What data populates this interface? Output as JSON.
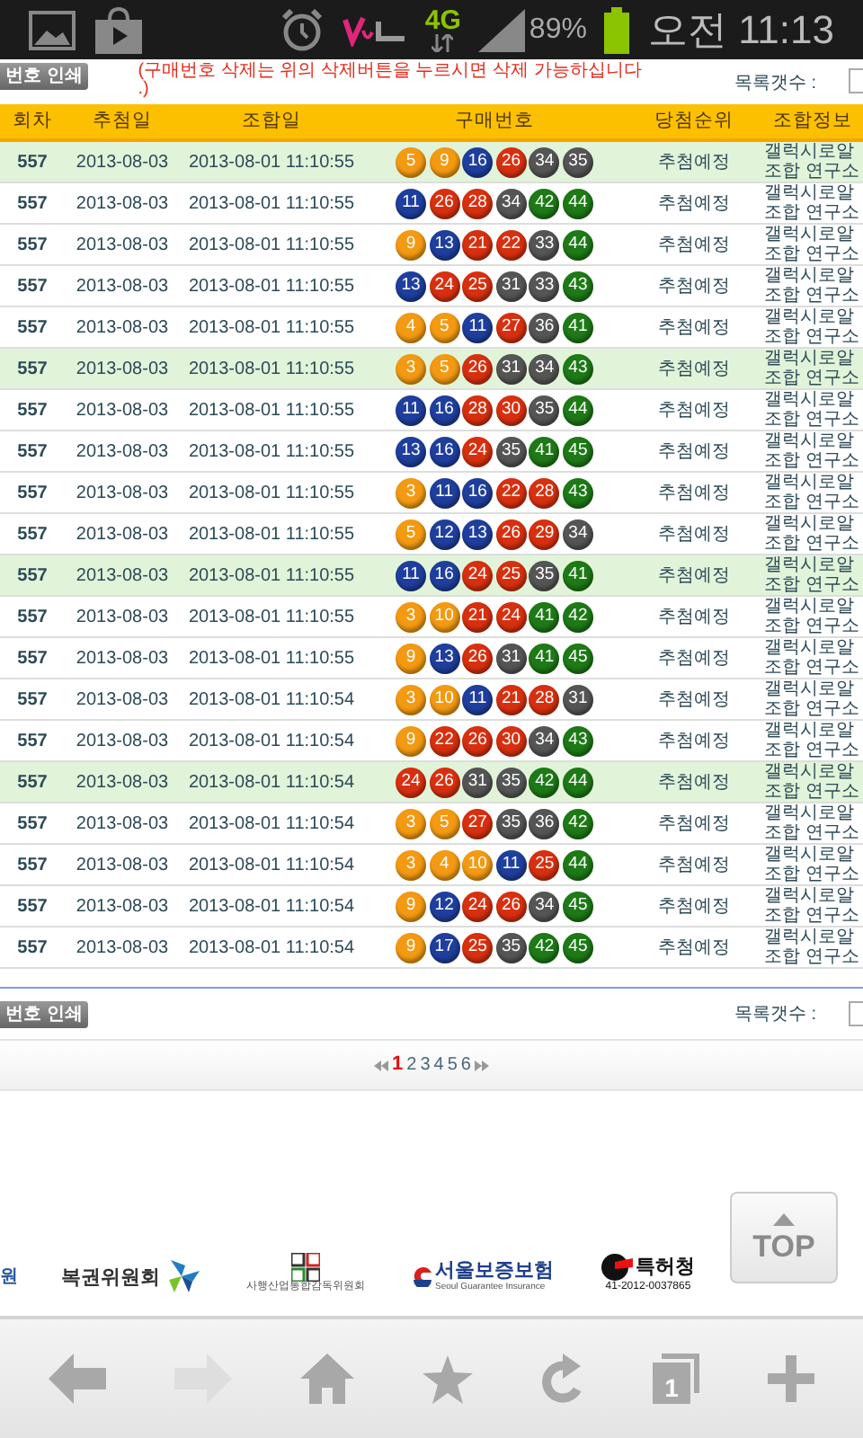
{
  "status_bar": {
    "network": "4G",
    "battery": "89%",
    "time": "오전 11:13"
  },
  "top_bar": {
    "print_button": "번호 인쇄",
    "notice_lines": [
      "(구매번호 삭제는 위의 삭제버튼을 누르시면 삭제 가능하십니다",
      ".)"
    ],
    "list_count_label": "목록갯수 :"
  },
  "table": {
    "columns": [
      "회차",
      "추첨일",
      "조합일",
      "구매번호",
      "당첨순위",
      "조합정보"
    ],
    "rows": [
      {
        "round": "557",
        "draw_date": "2013-08-03",
        "combo_date": "2013-08-01 11:10:55",
        "highlighted": true,
        "balls": [
          {
            "n": "5",
            "color": "#f39a12"
          },
          {
            "n": "9",
            "color": "#f39a12"
          },
          {
            "n": "16",
            "color": "#1f3f9e"
          },
          {
            "n": "26",
            "color": "#d8300f"
          },
          {
            "n": "34",
            "color": "#555555"
          },
          {
            "n": "35",
            "color": "#555555"
          }
        ],
        "rank": "추첨예정",
        "info": [
          "갤럭시로알",
          "조합 연구소"
        ]
      },
      {
        "round": "557",
        "draw_date": "2013-08-03",
        "combo_date": "2013-08-01 11:10:55",
        "highlighted": false,
        "balls": [
          {
            "n": "11",
            "color": "#1f3f9e"
          },
          {
            "n": "26",
            "color": "#d8300f"
          },
          {
            "n": "28",
            "color": "#d8300f"
          },
          {
            "n": "34",
            "color": "#555555"
          },
          {
            "n": "42",
            "color": "#1d7a16"
          },
          {
            "n": "44",
            "color": "#1d7a16"
          }
        ],
        "rank": "추첨예정",
        "info": [
          "갤럭시로알",
          "조합 연구소"
        ]
      },
      {
        "round": "557",
        "draw_date": "2013-08-03",
        "combo_date": "2013-08-01 11:10:55",
        "highlighted": false,
        "balls": [
          {
            "n": "9",
            "color": "#f39a12"
          },
          {
            "n": "13",
            "color": "#1f3f9e"
          },
          {
            "n": "21",
            "color": "#d8300f"
          },
          {
            "n": "22",
            "color": "#d8300f"
          },
          {
            "n": "33",
            "color": "#555555"
          },
          {
            "n": "44",
            "color": "#1d7a16"
          }
        ],
        "rank": "추첨예정",
        "info": [
          "갤럭시로알",
          "조합 연구소"
        ]
      },
      {
        "round": "557",
        "draw_date": "2013-08-03",
        "combo_date": "2013-08-01 11:10:55",
        "highlighted": false,
        "balls": [
          {
            "n": "13",
            "color": "#1f3f9e"
          },
          {
            "n": "24",
            "color": "#d8300f"
          },
          {
            "n": "25",
            "color": "#d8300f"
          },
          {
            "n": "31",
            "color": "#555555"
          },
          {
            "n": "33",
            "color": "#555555"
          },
          {
            "n": "43",
            "color": "#1d7a16"
          }
        ],
        "rank": "추첨예정",
        "info": [
          "갤럭시로알",
          "조합 연구소"
        ]
      },
      {
        "round": "557",
        "draw_date": "2013-08-03",
        "combo_date": "2013-08-01 11:10:55",
        "highlighted": false,
        "balls": [
          {
            "n": "4",
            "color": "#f39a12"
          },
          {
            "n": "5",
            "color": "#f39a12"
          },
          {
            "n": "11",
            "color": "#1f3f9e"
          },
          {
            "n": "27",
            "color": "#d8300f"
          },
          {
            "n": "36",
            "color": "#555555"
          },
          {
            "n": "41",
            "color": "#1d7a16"
          }
        ],
        "rank": "추첨예정",
        "info": [
          "갤럭시로알",
          "조합 연구소"
        ]
      },
      {
        "round": "557",
        "draw_date": "2013-08-03",
        "combo_date": "2013-08-01 11:10:55",
        "highlighted": true,
        "balls": [
          {
            "n": "3",
            "color": "#f39a12"
          },
          {
            "n": "5",
            "color": "#f39a12"
          },
          {
            "n": "26",
            "color": "#d8300f"
          },
          {
            "n": "31",
            "color": "#555555"
          },
          {
            "n": "34",
            "color": "#555555"
          },
          {
            "n": "43",
            "color": "#1d7a16"
          }
        ],
        "rank": "추첨예정",
        "info": [
          "갤럭시로알",
          "조합 연구소"
        ]
      },
      {
        "round": "557",
        "draw_date": "2013-08-03",
        "combo_date": "2013-08-01 11:10:55",
        "highlighted": false,
        "balls": [
          {
            "n": "11",
            "color": "#1f3f9e"
          },
          {
            "n": "16",
            "color": "#1f3f9e"
          },
          {
            "n": "28",
            "color": "#d8300f"
          },
          {
            "n": "30",
            "color": "#d8300f"
          },
          {
            "n": "35",
            "color": "#555555"
          },
          {
            "n": "44",
            "color": "#1d7a16"
          }
        ],
        "rank": "추첨예정",
        "info": [
          "갤럭시로알",
          "조합 연구소"
        ]
      },
      {
        "round": "557",
        "draw_date": "2013-08-03",
        "combo_date": "2013-08-01 11:10:55",
        "highlighted": false,
        "balls": [
          {
            "n": "13",
            "color": "#1f3f9e"
          },
          {
            "n": "16",
            "color": "#1f3f9e"
          },
          {
            "n": "24",
            "color": "#d8300f"
          },
          {
            "n": "35",
            "color": "#555555"
          },
          {
            "n": "41",
            "color": "#1d7a16"
          },
          {
            "n": "45",
            "color": "#1d7a16"
          }
        ],
        "rank": "추첨예정",
        "info": [
          "갤럭시로알",
          "조합 연구소"
        ]
      },
      {
        "round": "557",
        "draw_date": "2013-08-03",
        "combo_date": "2013-08-01 11:10:55",
        "highlighted": false,
        "balls": [
          {
            "n": "3",
            "color": "#f39a12"
          },
          {
            "n": "11",
            "color": "#1f3f9e"
          },
          {
            "n": "16",
            "color": "#1f3f9e"
          },
          {
            "n": "22",
            "color": "#d8300f"
          },
          {
            "n": "28",
            "color": "#d8300f"
          },
          {
            "n": "43",
            "color": "#1d7a16"
          }
        ],
        "rank": "추첨예정",
        "info": [
          "갤럭시로알",
          "조합 연구소"
        ]
      },
      {
        "round": "557",
        "draw_date": "2013-08-03",
        "combo_date": "2013-08-01 11:10:55",
        "highlighted": false,
        "balls": [
          {
            "n": "5",
            "color": "#f39a12"
          },
          {
            "n": "12",
            "color": "#1f3f9e"
          },
          {
            "n": "13",
            "color": "#1f3f9e"
          },
          {
            "n": "26",
            "color": "#d8300f"
          },
          {
            "n": "29",
            "color": "#d8300f"
          },
          {
            "n": "34",
            "color": "#555555"
          }
        ],
        "rank": "추첨예정",
        "info": [
          "갤럭시로알",
          "조합 연구소"
        ]
      },
      {
        "round": "557",
        "draw_date": "2013-08-03",
        "combo_date": "2013-08-01 11:10:55",
        "highlighted": true,
        "balls": [
          {
            "n": "11",
            "color": "#1f3f9e"
          },
          {
            "n": "16",
            "color": "#1f3f9e"
          },
          {
            "n": "24",
            "color": "#d8300f"
          },
          {
            "n": "25",
            "color": "#d8300f"
          },
          {
            "n": "35",
            "color": "#555555"
          },
          {
            "n": "41",
            "color": "#1d7a16"
          }
        ],
        "rank": "추첨예정",
        "info": [
          "갤럭시로알",
          "조합 연구소"
        ]
      },
      {
        "round": "557",
        "draw_date": "2013-08-03",
        "combo_date": "2013-08-01 11:10:55",
        "highlighted": false,
        "balls": [
          {
            "n": "3",
            "color": "#f39a12"
          },
          {
            "n": "10",
            "color": "#f39a12"
          },
          {
            "n": "21",
            "color": "#d8300f"
          },
          {
            "n": "24",
            "color": "#d8300f"
          },
          {
            "n": "41",
            "color": "#1d7a16"
          },
          {
            "n": "42",
            "color": "#1d7a16"
          }
        ],
        "rank": "추첨예정",
        "info": [
          "갤럭시로알",
          "조합 연구소"
        ]
      },
      {
        "round": "557",
        "draw_date": "2013-08-03",
        "combo_date": "2013-08-01 11:10:55",
        "highlighted": false,
        "balls": [
          {
            "n": "9",
            "color": "#f39a12"
          },
          {
            "n": "13",
            "color": "#1f3f9e"
          },
          {
            "n": "26",
            "color": "#d8300f"
          },
          {
            "n": "31",
            "color": "#555555"
          },
          {
            "n": "41",
            "color": "#1d7a16"
          },
          {
            "n": "45",
            "color": "#1d7a16"
          }
        ],
        "rank": "추첨예정",
        "info": [
          "갤럭시로알",
          "조합 연구소"
        ]
      },
      {
        "round": "557",
        "draw_date": "2013-08-03",
        "combo_date": "2013-08-01 11:10:54",
        "highlighted": false,
        "balls": [
          {
            "n": "3",
            "color": "#f39a12"
          },
          {
            "n": "10",
            "color": "#f39a12"
          },
          {
            "n": "11",
            "color": "#1f3f9e"
          },
          {
            "n": "21",
            "color": "#d8300f"
          },
          {
            "n": "28",
            "color": "#d8300f"
          },
          {
            "n": "31",
            "color": "#555555"
          }
        ],
        "rank": "추첨예정",
        "info": [
          "갤럭시로알",
          "조합 연구소"
        ]
      },
      {
        "round": "557",
        "draw_date": "2013-08-03",
        "combo_date": "2013-08-01 11:10:54",
        "highlighted": false,
        "balls": [
          {
            "n": "9",
            "color": "#f39a12"
          },
          {
            "n": "22",
            "color": "#d8300f"
          },
          {
            "n": "26",
            "color": "#d8300f"
          },
          {
            "n": "30",
            "color": "#d8300f"
          },
          {
            "n": "34",
            "color": "#555555"
          },
          {
            "n": "43",
            "color": "#1d7a16"
          }
        ],
        "rank": "추첨예정",
        "info": [
          "갤럭시로알",
          "조합 연구소"
        ]
      },
      {
        "round": "557",
        "draw_date": "2013-08-03",
        "combo_date": "2013-08-01 11:10:54",
        "highlighted": true,
        "balls": [
          {
            "n": "24",
            "color": "#d8300f"
          },
          {
            "n": "26",
            "color": "#d8300f"
          },
          {
            "n": "31",
            "color": "#555555"
          },
          {
            "n": "35",
            "color": "#555555"
          },
          {
            "n": "42",
            "color": "#1d7a16"
          },
          {
            "n": "44",
            "color": "#1d7a16"
          }
        ],
        "rank": "추첨예정",
        "info": [
          "갤럭시로알",
          "조합 연구소"
        ]
      },
      {
        "round": "557",
        "draw_date": "2013-08-03",
        "combo_date": "2013-08-01 11:10:54",
        "highlighted": false,
        "balls": [
          {
            "n": "3",
            "color": "#f39a12"
          },
          {
            "n": "5",
            "color": "#f39a12"
          },
          {
            "n": "27",
            "color": "#d8300f"
          },
          {
            "n": "35",
            "color": "#555555"
          },
          {
            "n": "36",
            "color": "#555555"
          },
          {
            "n": "42",
            "color": "#1d7a16"
          }
        ],
        "rank": "추첨예정",
        "info": [
          "갤럭시로알",
          "조합 연구소"
        ]
      },
      {
        "round": "557",
        "draw_date": "2013-08-03",
        "combo_date": "2013-08-01 11:10:54",
        "highlighted": false,
        "balls": [
          {
            "n": "3",
            "color": "#f39a12"
          },
          {
            "n": "4",
            "color": "#f39a12"
          },
          {
            "n": "10",
            "color": "#f39a12"
          },
          {
            "n": "11",
            "color": "#1f3f9e"
          },
          {
            "n": "25",
            "color": "#d8300f"
          },
          {
            "n": "44",
            "color": "#1d7a16"
          }
        ],
        "rank": "추첨예정",
        "info": [
          "갤럭시로알",
          "조합 연구소"
        ]
      },
      {
        "round": "557",
        "draw_date": "2013-08-03",
        "combo_date": "2013-08-01 11:10:54",
        "highlighted": false,
        "balls": [
          {
            "n": "9",
            "color": "#f39a12"
          },
          {
            "n": "12",
            "color": "#1f3f9e"
          },
          {
            "n": "24",
            "color": "#d8300f"
          },
          {
            "n": "26",
            "color": "#d8300f"
          },
          {
            "n": "34",
            "color": "#555555"
          },
          {
            "n": "45",
            "color": "#1d7a16"
          }
        ],
        "rank": "추첨예정",
        "info": [
          "갤럭시로알",
          "조합 연구소"
        ]
      },
      {
        "round": "557",
        "draw_date": "2013-08-03",
        "combo_date": "2013-08-01 11:10:54",
        "highlighted": false,
        "balls": [
          {
            "n": "9",
            "color": "#f39a12"
          },
          {
            "n": "17",
            "color": "#1f3f9e"
          },
          {
            "n": "25",
            "color": "#d8300f"
          },
          {
            "n": "35",
            "color": "#555555"
          },
          {
            "n": "42",
            "color": "#1d7a16"
          },
          {
            "n": "45",
            "color": "#1d7a16"
          }
        ],
        "rank": "추첨예정",
        "info": [
          "갤럭시로알",
          "조합 연구소"
        ]
      }
    ]
  },
  "bottom_bar": {
    "print_button": "번호 인쇄",
    "list_count_label": "목록갯수 :"
  },
  "pagination": {
    "pages": [
      {
        "label": "1",
        "selected": true
      },
      {
        "label": "2",
        "selected": false
      },
      {
        "label": "3",
        "selected": false
      },
      {
        "label": "4",
        "selected": false
      },
      {
        "label": "5",
        "selected": false
      },
      {
        "label": "6",
        "selected": false
      }
    ]
  },
  "footer": {
    "logos": [
      {
        "kind": "text",
        "label": "원"
      },
      {
        "kind": "pinwheel",
        "label": "복권위원회"
      },
      {
        "kind": "blocks",
        "caption": "사행산업통합감독위원회"
      },
      {
        "kind": "swirl",
        "label": "서울보증보험",
        "caption": "Seoul Guarantee Insurance"
      },
      {
        "kind": "flag",
        "label": "특허청",
        "caption": "41-2012-0037865"
      }
    ],
    "top_button": "TOP"
  },
  "browser_toolbar": {
    "buttons": [
      {
        "kind": "back",
        "disabled": false
      },
      {
        "kind": "forward",
        "disabled": true
      },
      {
        "kind": "home",
        "disabled": false
      },
      {
        "kind": "bookmark",
        "disabled": false
      },
      {
        "kind": "refresh",
        "disabled": false
      },
      {
        "kind": "tabs",
        "disabled": false
      },
      {
        "kind": "new_tab",
        "disabled": false
      }
    ],
    "tab_count": "1"
  }
}
